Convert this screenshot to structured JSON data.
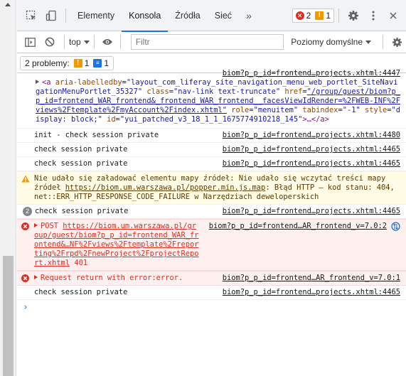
{
  "tabs": [
    {
      "label": "Elementy"
    },
    {
      "label": "Konsola"
    },
    {
      "label": "Źródła"
    },
    {
      "label": "Sieć"
    }
  ],
  "more_tabs": "»",
  "counts": {
    "errors": "2",
    "warnings": "1"
  },
  "toolbar": {
    "context": "top",
    "filter_placeholder": "Filtr",
    "levels": "Poziomy domyślne"
  },
  "issues": {
    "label": "2 problemy:",
    "warnings": "1",
    "info": "1"
  },
  "colors": {
    "accent": "#1a73e8",
    "error": "#d93025",
    "warning": "#f29900"
  },
  "messages": [
    {
      "type": "element",
      "source": "biom?p_p_id=frontend…projects.xhtml:4447",
      "tag_open": "<a",
      "attrs": [
        {
          "name": "aria-labelledby",
          "value": "\"layout_com_liferay_site_navigation_menu_web_portlet_SiteNavigationMenuPortlet_35327\""
        },
        {
          "name": "class",
          "value": "\"nav-link text-truncate\""
        },
        {
          "name": "href",
          "value": "\"/group/guest/biom?p_p_id=frontend_WAR_frontend&_frontend_WAR_frontend__facesViewIdRender=%2FWEB-INF%2Fviews%2Ftemplate%2FmyAccount%2Findex.xhtml\""
        },
        {
          "name": "role",
          "value": "\"menuitem\""
        },
        {
          "name": "tabindex",
          "value": "\"-1\""
        },
        {
          "name": "style",
          "value": "\"display: block;\""
        },
        {
          "name": "id",
          "value": "\"yui_patched_v3_18_1_1_1675774910218_145\""
        }
      ],
      "tag_close": ">…</a>"
    },
    {
      "type": "log",
      "text": "init - check session private",
      "source": "biom?p_p_id=frontend…projects.xhtml:4480"
    },
    {
      "type": "log",
      "text": "check session private",
      "source": "biom?p_p_id=frontend…projects.xhtml:4465"
    },
    {
      "type": "log",
      "text": "check session private",
      "source": "biom?p_p_id=frontend…projects.xhtml:4465"
    },
    {
      "type": "warning",
      "text_a": "Nie udało się załadować elementu mapy źródeł: Nie udało się wczytać treści mapy źródeł ",
      "link": "https://biom.um.warszawa.pl/popper.min.js.map",
      "text_b": ": Błąd HTTP – kod stanu: 404, net::ERR_HTTP_RESPONSE_CODE_FAILURE w Narzędziach deweloperskich"
    },
    {
      "type": "log",
      "count": "2",
      "text": "check session private",
      "source": "biom?p_p_id=frontend…projects.xhtml:4465"
    },
    {
      "type": "error",
      "method": "POST",
      "link": "https://biom.um.warszawa.pl/group/guest/biom?p_p_id=frontend_WAR_frontend&…NF%2Fviews%2Ftemplate%2Freporting%2Frpd%2FnewProject%2FprojectReport.xhtml",
      "status": "401",
      "source": "biom?p_p_id=frontend…AR_frontend_v=7.0:2"
    },
    {
      "type": "error",
      "text": "Request return with error:error.",
      "source": "biom?p_p_id=frontend…AR_frontend_v=7.0:1"
    },
    {
      "type": "log",
      "text": "check session private",
      "source": "biom?p_p_id=frontend…projects.xhtml:4465"
    }
  ],
  "prompt": "›"
}
